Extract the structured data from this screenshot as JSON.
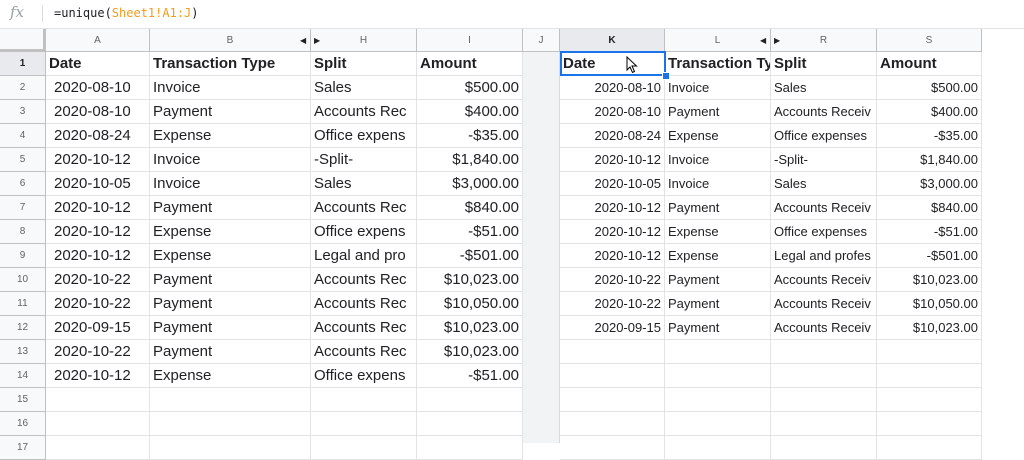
{
  "formula_bar": {
    "icon": "fx-icon",
    "prefix": "=unique(",
    "range": "Sheet1!A1:J",
    "suffix": ")"
  },
  "columns": [
    {
      "label": "A"
    },
    {
      "label": "B"
    },
    {
      "label": "H"
    },
    {
      "label": "I"
    },
    {
      "label": "J"
    },
    {
      "label": "K"
    },
    {
      "label": "L"
    },
    {
      "label": "R"
    },
    {
      "label": "S"
    }
  ],
  "rows": [
    "1",
    "2",
    "3",
    "4",
    "5",
    "6",
    "7",
    "8",
    "9",
    "10",
    "11",
    "12",
    "13",
    "14",
    "15",
    "16",
    "17"
  ],
  "left_table": {
    "headers": [
      "Date",
      "Transaction Type",
      "Split",
      "Amount"
    ],
    "rows": [
      [
        "2020-08-10",
        "Invoice",
        "Sales",
        "$500.00"
      ],
      [
        "2020-08-10",
        "Payment",
        "Accounts Rec",
        "$400.00"
      ],
      [
        "2020-08-24",
        "Expense",
        "Office expens",
        "-$35.00"
      ],
      [
        "2020-10-12",
        "Invoice",
        "-Split-",
        "$1,840.00"
      ],
      [
        "2020-10-05",
        "Invoice",
        "Sales",
        "$3,000.00"
      ],
      [
        "2020-10-12",
        "Payment",
        "Accounts Rec",
        "$840.00"
      ],
      [
        "2020-10-12",
        "Expense",
        "Office expens",
        "-$51.00"
      ],
      [
        "2020-10-12",
        "Expense",
        "Legal and pro",
        "-$501.00"
      ],
      [
        "2020-10-22",
        "Payment",
        "Accounts Rec",
        "$10,023.00"
      ],
      [
        "2020-10-22",
        "Payment",
        "Accounts Rec",
        "$10,050.00"
      ],
      [
        "2020-09-15",
        "Payment",
        "Accounts Rec",
        "$10,023.00"
      ],
      [
        "2020-10-22",
        "Payment",
        "Accounts Rec",
        "$10,023.00"
      ],
      [
        "2020-10-12",
        "Expense",
        "Office expens",
        "-$51.00"
      ]
    ]
  },
  "right_table": {
    "headers": [
      "Date",
      "Transaction Type",
      "Split",
      "Amount"
    ],
    "rows": [
      [
        "2020-08-10",
        "Invoice",
        "Sales",
        "$500.00"
      ],
      [
        "2020-08-10",
        "Payment",
        "Accounts Receiv",
        "$400.00"
      ],
      [
        "2020-08-24",
        "Expense",
        "Office expenses",
        "-$35.00"
      ],
      [
        "2020-10-12",
        "Invoice",
        "-Split-",
        "$1,840.00"
      ],
      [
        "2020-10-05",
        "Invoice",
        "Sales",
        "$3,000.00"
      ],
      [
        "2020-10-12",
        "Payment",
        "Accounts Receiv",
        "$840.00"
      ],
      [
        "2020-10-12",
        "Expense",
        "Office expenses",
        "-$51.00"
      ],
      [
        "2020-10-12",
        "Expense",
        "Legal and profes",
        "-$501.00"
      ],
      [
        "2020-10-22",
        "Payment",
        "Accounts Receiv",
        "$10,023.00"
      ],
      [
        "2020-10-22",
        "Payment",
        "Accounts Receiv",
        "$10,050.00"
      ],
      [
        "2020-09-15",
        "Payment",
        "Accounts Receiv",
        "$10,023.00"
      ]
    ]
  },
  "selected_cell": "K1",
  "colors": {
    "selection": "#1a73e8",
    "range_ref": "#f29c1c"
  }
}
